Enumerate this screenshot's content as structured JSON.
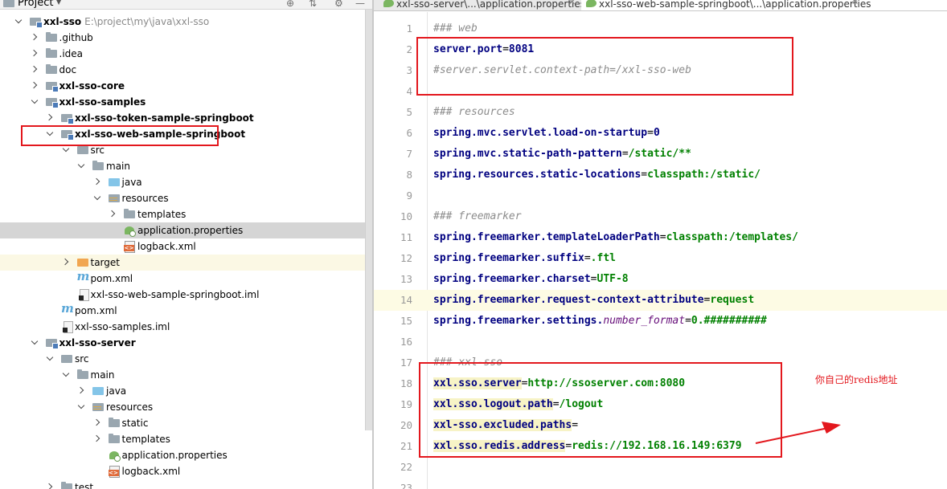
{
  "project_panel": {
    "title": "Project",
    "items": [
      {
        "label": "xxl-sso",
        "path": "E:\\project\\my\\java\\xxl-sso",
        "bold": true,
        "icon": "module-folder-icon",
        "state": "expanded",
        "depth": 0
      },
      {
        "label": ".github",
        "icon": "folder-icon",
        "state": "collapsed",
        "depth": 1
      },
      {
        "label": ".idea",
        "icon": "folder-icon",
        "state": "collapsed",
        "depth": 1
      },
      {
        "label": "doc",
        "icon": "folder-icon",
        "state": "collapsed",
        "depth": 1
      },
      {
        "label": "xxl-sso-core",
        "bold": true,
        "icon": "module-folder-icon",
        "state": "collapsed",
        "depth": 1
      },
      {
        "label": "xxl-sso-samples",
        "bold": true,
        "icon": "module-folder-icon",
        "state": "expanded",
        "depth": 1
      },
      {
        "label": "xxl-sso-token-sample-springboot",
        "bold": true,
        "icon": "module-folder-icon",
        "state": "collapsed",
        "depth": 2
      },
      {
        "label": "xxl-sso-web-sample-springboot",
        "bold": true,
        "icon": "module-folder-icon",
        "state": "expanded",
        "depth": 2
      },
      {
        "label": "src",
        "icon": "source-folder-icon",
        "state": "expanded",
        "depth": 3
      },
      {
        "label": "main",
        "icon": "folder-icon",
        "state": "expanded",
        "depth": 4
      },
      {
        "label": "java",
        "icon": "java-folder-icon",
        "state": "collapsed",
        "depth": 5
      },
      {
        "label": "resources",
        "icon": "resources-folder-icon",
        "state": "expanded",
        "depth": 5
      },
      {
        "label": "templates",
        "icon": "folder-icon",
        "state": "collapsed",
        "depth": 6
      },
      {
        "label": "application.properties",
        "icon": "spring-properties-icon",
        "state": "leaf",
        "depth": 6,
        "selected": true
      },
      {
        "label": "logback.xml",
        "icon": "xml-file-icon",
        "state": "leaf",
        "depth": 6
      },
      {
        "label": "target",
        "icon": "excluded-folder-icon",
        "state": "collapsed",
        "depth": 3,
        "excluded": true
      },
      {
        "label": "pom.xml",
        "icon": "maven-icon",
        "state": "leaf",
        "depth": 3
      },
      {
        "label": "xxl-sso-web-sample-springboot.iml",
        "icon": "iml-file-icon",
        "state": "leaf",
        "depth": 3
      },
      {
        "label": "pom.xml",
        "icon": "maven-icon",
        "state": "leaf",
        "depth": 2
      },
      {
        "label": "xxl-sso-samples.iml",
        "icon": "iml-file-icon",
        "state": "leaf",
        "depth": 2
      },
      {
        "label": "xxl-sso-server",
        "bold": true,
        "icon": "module-folder-icon",
        "state": "expanded",
        "depth": 1
      },
      {
        "label": "src",
        "icon": "source-folder-icon",
        "state": "expanded",
        "depth": 2
      },
      {
        "label": "main",
        "icon": "folder-icon",
        "state": "expanded",
        "depth": 3
      },
      {
        "label": "java",
        "icon": "java-folder-icon",
        "state": "collapsed",
        "depth": 4
      },
      {
        "label": "resources",
        "icon": "resources-folder-icon",
        "state": "expanded",
        "depth": 4
      },
      {
        "label": "static",
        "icon": "folder-icon",
        "state": "collapsed",
        "depth": 5
      },
      {
        "label": "templates",
        "icon": "folder-icon",
        "state": "collapsed",
        "depth": 5
      },
      {
        "label": "application.properties",
        "icon": "spring-properties-icon",
        "state": "leaf",
        "depth": 5
      },
      {
        "label": "logback.xml",
        "icon": "xml-file-icon",
        "state": "leaf",
        "depth": 5
      },
      {
        "label": "test",
        "icon": "folder-icon",
        "state": "collapsed",
        "depth": 2
      }
    ]
  },
  "tabs": [
    {
      "label": "xxl-sso-server\\...\\application.properties",
      "active": false
    },
    {
      "label": "xxl-sso-web-sample-springboot\\...\\application.properties",
      "active": true
    }
  ],
  "editor": {
    "current_line": 14,
    "lines": [
      {
        "n": "1",
        "tokens": [
          {
            "t": "### web",
            "c": "c-comment"
          }
        ]
      },
      {
        "n": "2",
        "tokens": [
          {
            "t": "server.port",
            "c": "c-key"
          },
          {
            "t": "=",
            "c": "c-eq"
          },
          {
            "t": "8081",
            "c": "c-key"
          }
        ]
      },
      {
        "n": "3",
        "tokens": [
          {
            "t": "#server.servlet.context-path=/xxl-sso-web",
            "c": "c-comment"
          }
        ]
      },
      {
        "n": "4",
        "tokens": []
      },
      {
        "n": "5",
        "tokens": [
          {
            "t": "### resources",
            "c": "c-comment"
          }
        ]
      },
      {
        "n": "6",
        "tokens": [
          {
            "t": "spring.mvc.servlet.load-on-startup",
            "c": "c-key"
          },
          {
            "t": "=",
            "c": "c-eq"
          },
          {
            "t": "0",
            "c": "c-key"
          }
        ]
      },
      {
        "n": "7",
        "tokens": [
          {
            "t": "spring.mvc.static-path-pattern",
            "c": "c-key"
          },
          {
            "t": "=",
            "c": "c-eq"
          },
          {
            "t": "/static/**",
            "c": "c-val"
          }
        ]
      },
      {
        "n": "8",
        "tokens": [
          {
            "t": "spring.resources.static-locations",
            "c": "c-key"
          },
          {
            "t": "=",
            "c": "c-eq"
          },
          {
            "t": "classpath:/static/",
            "c": "c-val"
          }
        ]
      },
      {
        "n": "9",
        "tokens": []
      },
      {
        "n": "10",
        "tokens": [
          {
            "t": "### freemarker",
            "c": "c-comment"
          }
        ]
      },
      {
        "n": "11",
        "tokens": [
          {
            "t": "spring.freemarker.templateLoaderPath",
            "c": "c-key"
          },
          {
            "t": "=",
            "c": "c-eq"
          },
          {
            "t": "classpath:/templates/",
            "c": "c-val"
          }
        ]
      },
      {
        "n": "12",
        "tokens": [
          {
            "t": "spring.freemarker.suffix",
            "c": "c-key"
          },
          {
            "t": "=",
            "c": "c-eq"
          },
          {
            "t": ".ftl",
            "c": "c-val"
          }
        ]
      },
      {
        "n": "13",
        "tokens": [
          {
            "t": "spring.freemarker.charset",
            "c": "c-key"
          },
          {
            "t": "=",
            "c": "c-eq"
          },
          {
            "t": "UTF-8",
            "c": "c-val"
          }
        ]
      },
      {
        "n": "14",
        "tokens": [
          {
            "t": "spring.freemarker.request-context-attribute",
            "c": "c-key"
          },
          {
            "t": "=",
            "c": "c-eq"
          },
          {
            "t": "request",
            "c": "c-val"
          }
        ]
      },
      {
        "n": "15",
        "tokens": [
          {
            "t": "spring.freemarker.settings.",
            "c": "c-key"
          },
          {
            "t": "number_format",
            "c": "c-ital"
          },
          {
            "t": "=",
            "c": "c-eq"
          },
          {
            "t": "0.##########",
            "c": "c-val"
          }
        ]
      },
      {
        "n": "16",
        "tokens": []
      },
      {
        "n": "17",
        "tokens": [
          {
            "t": "### xxl-sso",
            "c": "c-comment"
          }
        ]
      },
      {
        "n": "18",
        "tokens": [
          {
            "t": "xxl.sso.server",
            "c": "c-key c-hl"
          },
          {
            "t": "=",
            "c": "c-eq"
          },
          {
            "t": "http://ssoserver.com:8080",
            "c": "c-val"
          }
        ]
      },
      {
        "n": "19",
        "tokens": [
          {
            "t": "xxl.sso.logout.path",
            "c": "c-key c-hl"
          },
          {
            "t": "=",
            "c": "c-eq"
          },
          {
            "t": "/logout",
            "c": "c-val"
          }
        ]
      },
      {
        "n": "20",
        "tokens": [
          {
            "t": "xxl-sso.excluded.paths",
            "c": "c-key c-hl"
          },
          {
            "t": "=",
            "c": "c-eq"
          }
        ]
      },
      {
        "n": "21",
        "tokens": [
          {
            "t": "xxl.sso.redis.address",
            "c": "c-key c-hl"
          },
          {
            "t": "=",
            "c": "c-eq"
          },
          {
            "t": "redis://192.168.16.149:6379",
            "c": "c-val"
          }
        ]
      },
      {
        "n": "22",
        "tokens": []
      },
      {
        "n": "23",
        "tokens": []
      }
    ]
  },
  "annotation": {
    "note": "你自己的redis地址",
    "color": "#e3171d"
  }
}
